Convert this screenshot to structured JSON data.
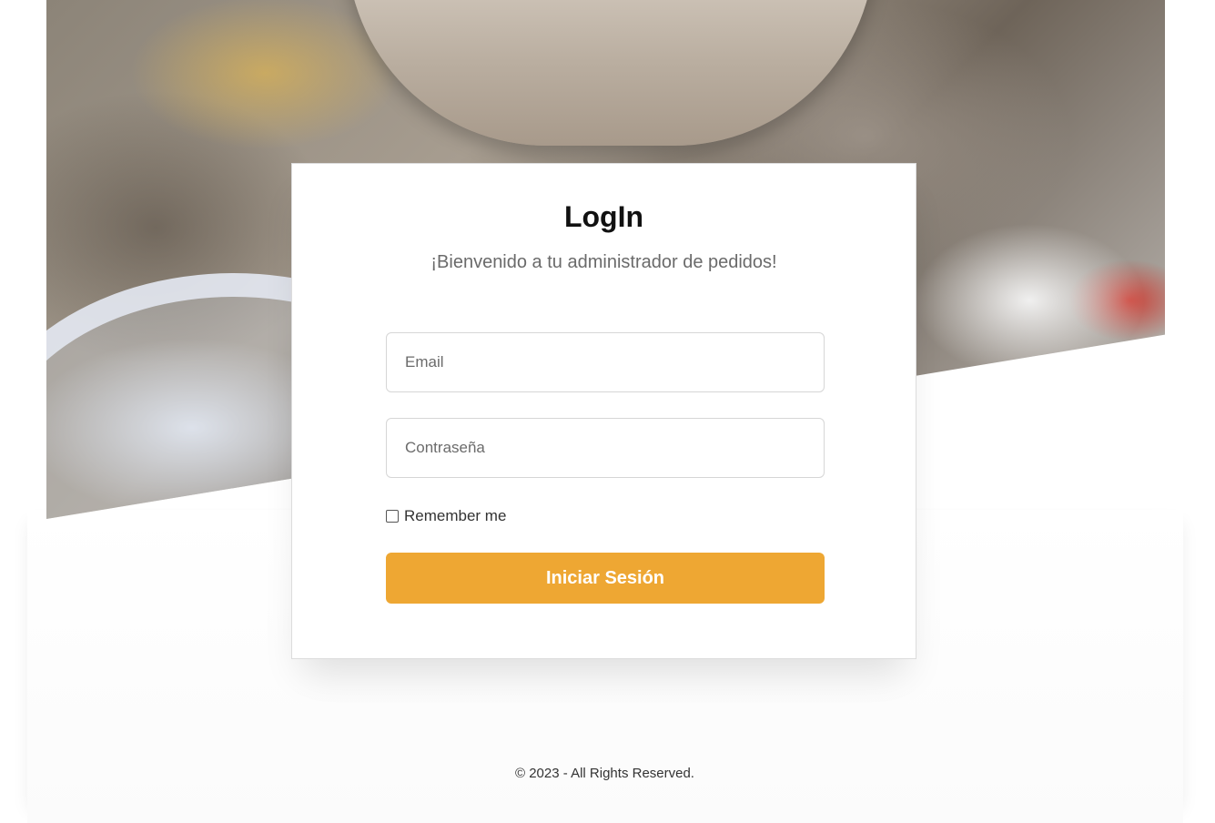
{
  "login": {
    "title": "LogIn",
    "subtitle": "¡Bienvenido a tu administrador de pedidos!",
    "email_placeholder": "Email",
    "password_placeholder": "Contraseña",
    "remember_label": "Remember me",
    "remember_checked": false,
    "submit_label": "Iniciar Sesión"
  },
  "footer": {
    "text": "© 2023 - All Rights Reserved."
  },
  "colors": {
    "accent": "#eea733",
    "background": "#ffffff"
  }
}
